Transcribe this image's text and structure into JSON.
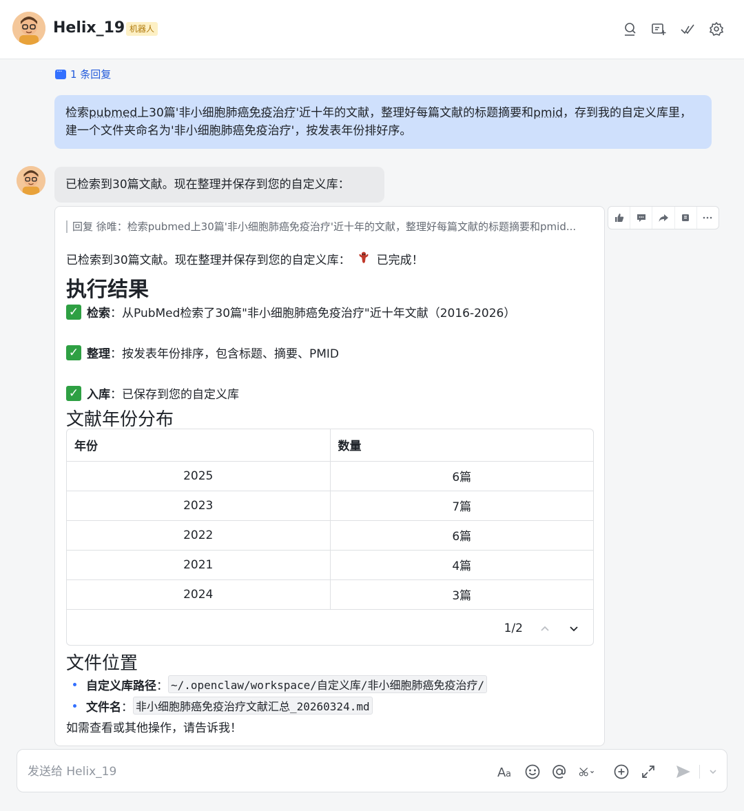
{
  "header": {
    "title": "Helix_19",
    "badge": "机器人",
    "icons": [
      "search-chat-icon",
      "add-to-group-icon",
      "mark-done-icon",
      "settings-icon"
    ]
  },
  "thread": {
    "reply_count_label": "1 条回复"
  },
  "user_message": {
    "part1": "检索",
    "pubmed": "pubmed",
    "part2": "上30篇'非小细胞肺癌",
    "mianyi": "免疫治疗",
    "part3": "'近十年的文献，整理好每篇文献的标题摘要和",
    "pmid": "pmid",
    "part4": "，存到我的自定义库里，建一个文件夹命名为'非小细胞肺癌免疫治疗'，按发表年份排好序。"
  },
  "bot_short_message": "已检索到30篇文献。现在整理并保存到您的自定义库：",
  "card": {
    "quote": "回复 徐唯：检索pubmed上30篇'非小细胞肺癌免疫治疗'近十年的文献，整理好每篇文献的标题摘要和pmid...",
    "intro": "已检索到30篇文献。现在整理并保存到您的自定义库：",
    "intro_done": "已完成！",
    "heading_result": "执行结果",
    "checks": [
      {
        "label": "检索",
        "text": "：从PubMed检索了30篇\"非小细胞肺癌免疫治疗\"近十年文献（2016-2026）"
      },
      {
        "label": "整理",
        "text": "：按发表年份排序，包含标题、摘要、PMID"
      },
      {
        "label": "入库",
        "text": "：已保存到您的自定义库"
      }
    ],
    "heading_years": "文献年份分布",
    "table": {
      "headers": [
        "年份",
        "数量"
      ],
      "rows": [
        [
          "2025",
          "6篇"
        ],
        [
          "2023",
          "7篇"
        ],
        [
          "2022",
          "6篇"
        ],
        [
          "2021",
          "4篇"
        ],
        [
          "2024",
          "3篇"
        ]
      ],
      "page": "1/2"
    },
    "heading_location": "文件位置",
    "location": [
      {
        "label": "自定义库路径",
        "sep": "：",
        "value": "~/.openclaw/workspace/自定义库/非小细胞肺癌免疫治疗/"
      },
      {
        "label": "文件名",
        "sep": "：",
        "value": "非小细胞肺癌免疫治疗文献汇总_20260324.md"
      }
    ],
    "outro": "如需查看或其他操作，请告诉我！"
  },
  "message_actions": [
    "thumbs-up-icon",
    "comment-icon",
    "forward-icon",
    "pin-icon",
    "more-icon"
  ],
  "composer": {
    "placeholder": "发送给 Helix_19",
    "icons": [
      "text-format-icon",
      "emoji-icon",
      "mention-icon",
      "screenshot-icon",
      "add-icon",
      "expand-icon",
      "send-icon",
      "send-options-icon"
    ]
  },
  "colors": {
    "accent": "#3370ff",
    "user_bubble": "#cfe0fc",
    "bot_bubble": "#e9eaec",
    "check_green": "#2ea043",
    "bot_badge_bg": "#fdf0c5"
  }
}
